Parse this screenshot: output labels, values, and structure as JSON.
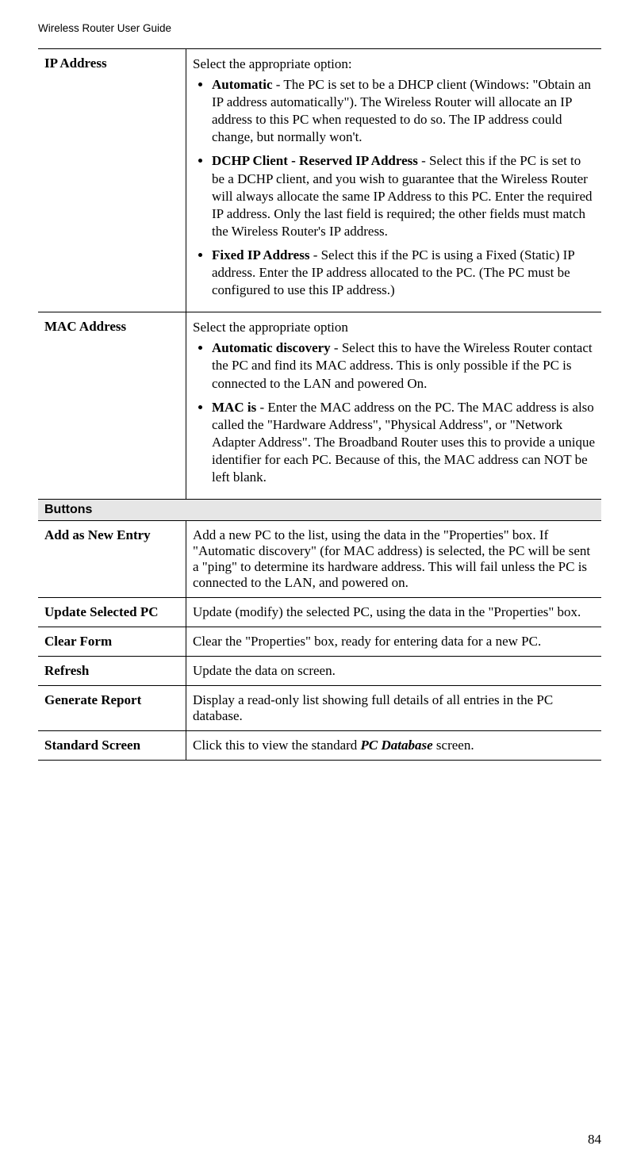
{
  "header": "Wireless Router User Guide",
  "pagenum": "84",
  "rows": {
    "ip": {
      "label": "IP Address",
      "lead": "Select the appropriate option:",
      "b1_strong": "Automatic",
      "b1_rest": " - The PC is set to be a DHCP client (Windows: \"Obtain an IP address automatically\"). The Wireless Router will allocate an IP address to this PC when requested to do so. The IP address could change, but normally won't.",
      "b2_strong": "DCHP Client - Reserved IP Address",
      "b2_rest": " - Select this if the PC is set to be a DCHP client, and you wish to guarantee that the Wireless Router will always allocate the same IP Address to this PC. Enter the required IP address. Only the last field is required; the other fields must match the Wireless Router's IP address.",
      "b3_strong": "Fixed IP Address",
      "b3_rest": " - Select this if the PC is using a Fixed (Static) IP address. Enter the IP address allocated to the PC. (The PC must be configured to use this IP address.)"
    },
    "mac": {
      "label": "MAC Address",
      "lead": "Select the appropriate option",
      "b1_strong": "Automatic discovery",
      "b1_rest": " - Select this to have the Wireless Router contact the PC and find its MAC address. This is only possible if the PC is connected to the LAN and powered On.",
      "b2_strong": "MAC is",
      "b2_rest": " - Enter the MAC address on the PC. The MAC address is also called the \"Hardware Address\", \"Physical Address\", or \"Network Adapter Address\". The Broadband Router uses this to provide a unique identifier for each PC. Because of this, the MAC address can NOT be left blank."
    },
    "section_buttons": "Buttons",
    "add": {
      "label": "Add as New Entry",
      "desc": "Add a new PC to the list, using the data in the \"Properties\" box. If \"Automatic discovery\" (for MAC address) is selected, the PC will be sent a \"ping\" to determine its hardware address. This will fail unless the PC is connected to the LAN, and powered on."
    },
    "update": {
      "label": "Update Selected PC",
      "desc": "Update (modify) the selected PC, using the data in the \"Properties\" box."
    },
    "clear": {
      "label": "Clear Form",
      "desc": "Clear the \"Properties\" box, ready for entering data for a new PC."
    },
    "refresh": {
      "label": "Refresh",
      "desc": "Update the data on screen."
    },
    "report": {
      "label": "Generate Report",
      "desc": "Display a read-only list showing full details of all entries in the PC database."
    },
    "standard": {
      "label": "Standard Screen",
      "pre": "Click this to view the standard ",
      "em": "PC Database",
      "post": " screen."
    }
  }
}
